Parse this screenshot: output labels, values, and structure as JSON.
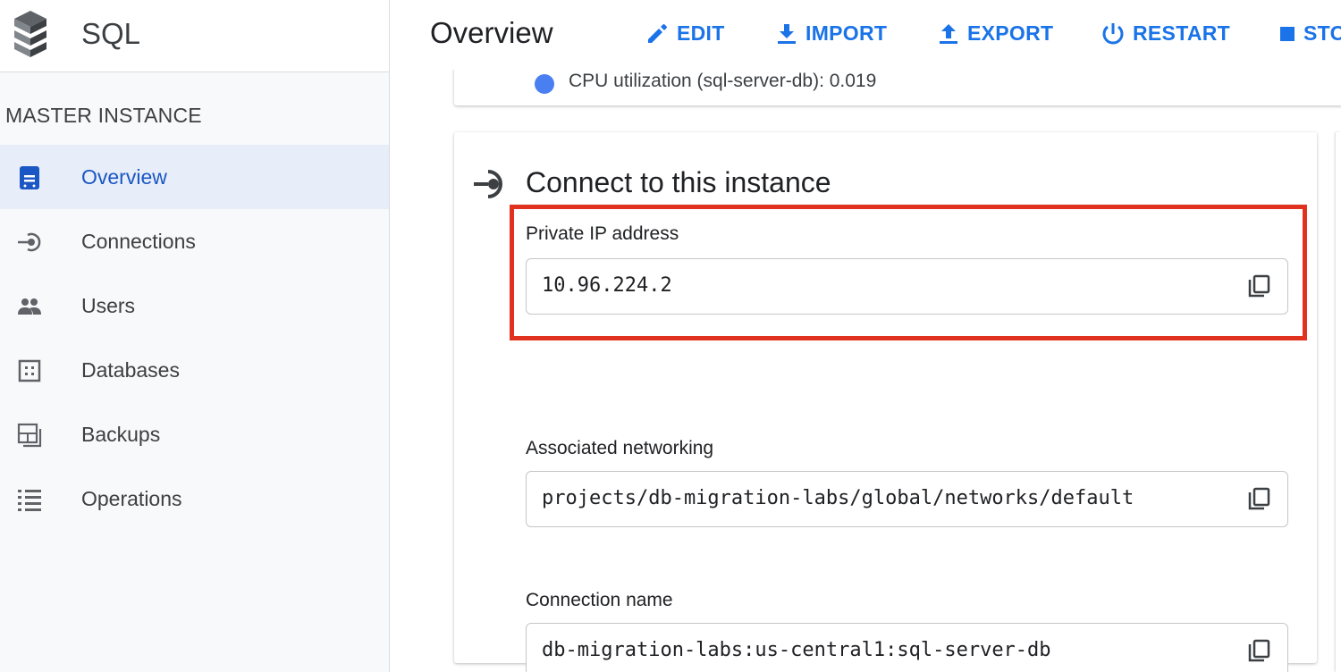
{
  "app": {
    "title": "SQL"
  },
  "sidebar": {
    "section_heading": "MASTER INSTANCE",
    "items": [
      {
        "label": "Overview",
        "icon": "instance-icon",
        "active": true
      },
      {
        "label": "Connections",
        "icon": "connections-icon",
        "active": false
      },
      {
        "label": "Users",
        "icon": "users-icon",
        "active": false
      },
      {
        "label": "Databases",
        "icon": "databases-icon",
        "active": false
      },
      {
        "label": "Backups",
        "icon": "backups-icon",
        "active": false
      },
      {
        "label": "Operations",
        "icon": "operations-icon",
        "active": false
      }
    ]
  },
  "header": {
    "page_title": "Overview",
    "actions": [
      {
        "label": "EDIT",
        "icon": "pencil-icon"
      },
      {
        "label": "IMPORT",
        "icon": "import-icon"
      },
      {
        "label": "EXPORT",
        "icon": "export-icon"
      },
      {
        "label": "RESTART",
        "icon": "power-icon"
      },
      {
        "label": "STO",
        "icon": "stop-icon"
      }
    ]
  },
  "metric": {
    "text": "CPU utilization (sql-server-db):  0.019",
    "dot_color": "#4a7ff2"
  },
  "connect_card": {
    "title": "Connect to this instance",
    "fields": [
      {
        "label": "Private IP address",
        "value": "10.96.224.2"
      },
      {
        "label": "Associated networking",
        "value": "projects/db-migration-labs/global/networks/default"
      },
      {
        "label": "Connection name",
        "value": "db-migration-labs:us-central1:sql-server-db"
      }
    ]
  },
  "colors": {
    "accent": "#1a73e8",
    "active_nav_bg": "#e8eef9",
    "highlight": "#e0321f"
  }
}
